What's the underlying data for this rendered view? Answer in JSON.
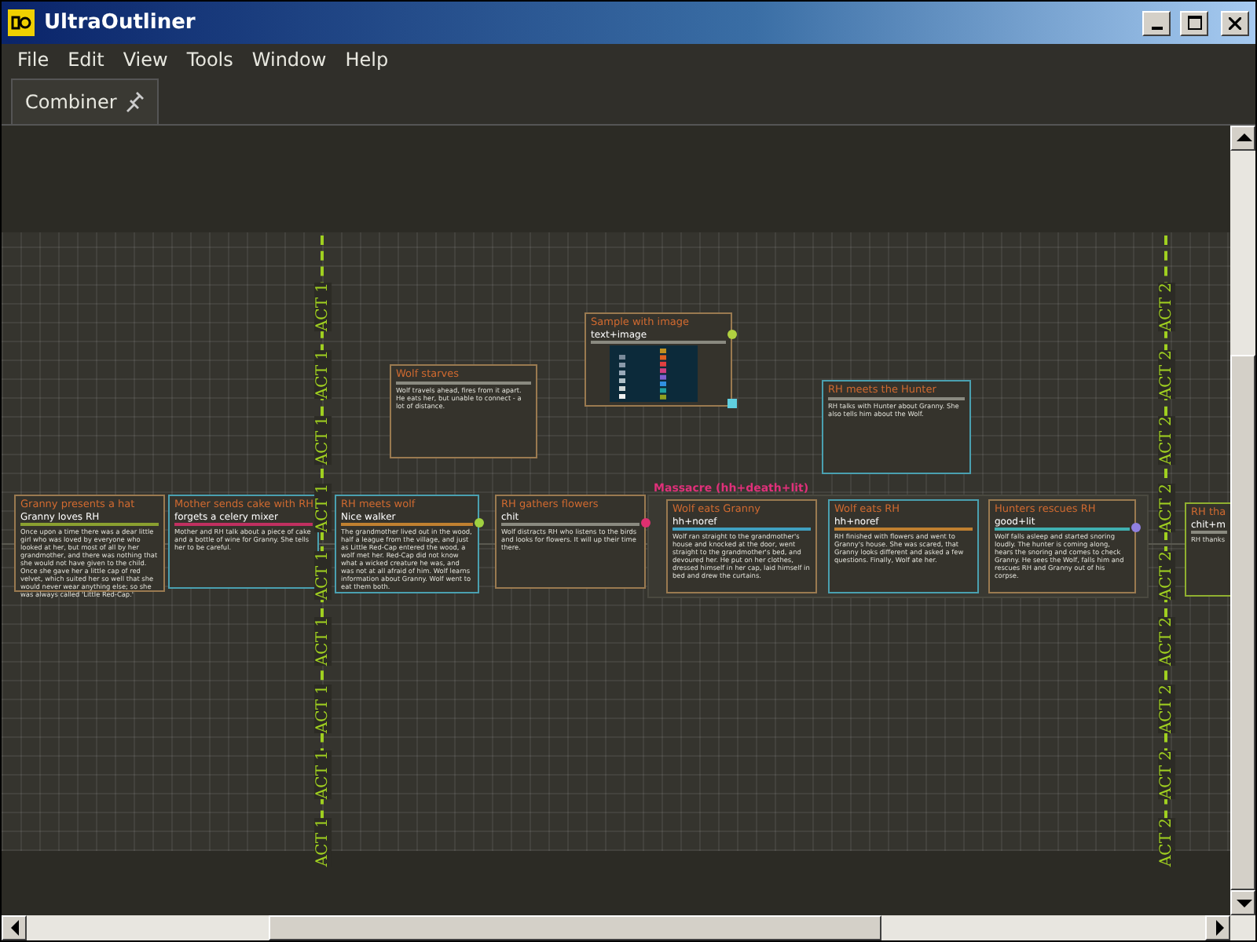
{
  "window": {
    "title": "UltraOutliner"
  },
  "menu": [
    "File",
    "Edit",
    "View",
    "Tools",
    "Window",
    "Help"
  ],
  "tabs": [
    {
      "label": "Combiner",
      "selected": true
    }
  ],
  "canvas": {
    "acts": [
      {
        "labels": [
          "ACT 1",
          "ACT 1",
          "ACT 1",
          "ACT 1",
          "ACT 1",
          "ACT 1",
          "ACT 1",
          "ACT 1",
          "ACT 1"
        ]
      },
      {
        "labels": [
          "ACT 2",
          "ACT 2",
          "ACT 2",
          "ACT 2",
          "ACT 2",
          "ACT 2",
          "ACT 2",
          "ACT 2",
          "ACT 2"
        ]
      }
    ],
    "cards": [
      {
        "kind": "text",
        "title": "Granny presents a hat",
        "tag": {
          "text": "Granny loves RH",
          "color": "#8aa030"
        },
        "text": "Once upon a time there was a dear little girl who was loved by everyone who looked at her, but most of all by her grandmother, and there was nothing that she would not have given to the child. Once she gave her a little cap of red velvet, which suited her so well that she would never wear anything else; so she was always called 'Little Red-Cap.'",
        "color": "#9a7a50"
      },
      {
        "kind": "text",
        "title": "Mother sends cake with RH",
        "tag": {
          "text": "forgets a celery mixer",
          "color": "#c03060"
        },
        "text": "Mother and RH talk about a piece of cake and a bottle of wine for Granny. She tells her to be careful.",
        "color": "#4aa0b0"
      },
      {
        "kind": "text",
        "title": "RH meets wolf",
        "tag": {
          "text": "Nice walker",
          "color": "#c08030"
        },
        "text": "The grandmother lived out in the wood, half a league from the village, and just as Little Red-Cap entered the wood, a wolf met her. Red-Cap did not know what a wicked creature he was, and was not at all afraid of him. Wolf learns information about Granny. Wolf went to eat them both.",
        "color": "#4aa0b0",
        "dot": {
          "color": "#a0d040"
        }
      },
      {
        "kind": "text",
        "title": "RH gathers flowers",
        "tag": {
          "text": "chit",
          "color": "#8a8a80"
        },
        "text": "Wolf distracts RH who listens to the birds and looks for flowers. It will up their time there.",
        "color": "#9a7a50",
        "dot": {
          "color": "#e03070"
        }
      },
      {
        "kind": "text",
        "title": "Wolf starves",
        "rule": {
          "color": "#8a8a80"
        },
        "text": "Wolf travels ahead, fires from it apart. He eats her, but unable to connect - a lot of distance.",
        "color": "#9a7a50"
      },
      {
        "kind": "image",
        "title": "Sample with image",
        "tag": {
          "text": "text+image",
          "color": "#8a8a80"
        },
        "color": "#9a7a50",
        "dot": {
          "color": "#b0d040"
        }
      },
      {
        "kind": "text",
        "title": "RH meets the Hunter",
        "rule": {
          "color": "#8a8a80"
        },
        "text": "RH talks with Hunter about Granny. She also tells him about the Wolf.",
        "color": "#4aa0b0"
      },
      {
        "kind": "text",
        "title": "RH tha",
        "tag": {
          "text": "chit+m",
          "color": "#8a8a80"
        },
        "text": "RH thanks",
        "color": "#90b030"
      }
    ],
    "groups": [
      {
        "label": "Massacre (hh+death+lit)",
        "color": "#e0307a",
        "cards": [
          {
            "kind": "text",
            "title": "Wolf eats Granny",
            "tag": {
              "text": "hh+noref",
              "color": "#40a0c0"
            },
            "text": "Wolf ran straight to the grandmother's house and knocked at the door, went straight to the grandmother's bed, and devoured her. He put on her clothes, dressed himself in her cap, laid himself in bed and drew the curtains.",
            "color": "#9a7a50"
          },
          {
            "kind": "text",
            "title": "Wolf eats RH",
            "tag": {
              "text": "hh+noref",
              "color": "#c08030"
            },
            "text": "RH finished with flowers and went to Granny's house. She was scared, that Granny looks different and asked a few questions. Finally, Wolf ate her.",
            "color": "#4aa0b0"
          },
          {
            "kind": "text",
            "title": "Hunters rescues RH",
            "tag": {
              "text": "good+lit",
              "color": "#40b0b0"
            },
            "text": "Wolf falls asleep and started snoring loudly. The hunter is coming along, hears the snoring and comes to check Granny. He sees the Wolf, falls him and rescues RH and Granny out of his corpse.",
            "color": "#9a7a50",
            "dot": {
              "color": "#9080e0"
            }
          }
        ]
      }
    ]
  }
}
